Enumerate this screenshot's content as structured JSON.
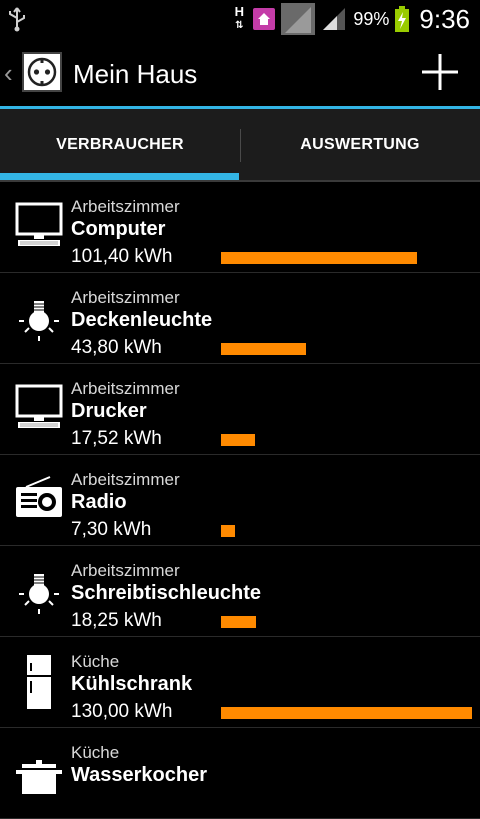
{
  "status_bar": {
    "network_type": "H",
    "battery_percent": "99%",
    "time": "9:36",
    "accent": "#33b5e5"
  },
  "action_bar": {
    "title": "Mein Haus",
    "add_icon": "plus-icon"
  },
  "tabs": [
    {
      "label": "VERBRAUCHER",
      "selected": true
    },
    {
      "label": "AUSWERTUNG",
      "selected": false
    }
  ],
  "consumers": [
    {
      "room": "Arbeitszimmer",
      "name": "Computer",
      "kwh": "101,40 kWh",
      "value": 101.4,
      "icon": "monitor-icon"
    },
    {
      "room": "Arbeitszimmer",
      "name": "Deckenleuchte",
      "kwh": "43,80 kWh",
      "value": 43.8,
      "icon": "lightbulb-icon"
    },
    {
      "room": "Arbeitszimmer",
      "name": "Drucker",
      "kwh": "17,52 kWh",
      "value": 17.52,
      "icon": "monitor-icon"
    },
    {
      "room": "Arbeitszimmer",
      "name": "Radio",
      "kwh": "7,30 kWh",
      "value": 7.3,
      "icon": "radio-icon"
    },
    {
      "room": "Arbeitszimmer",
      "name": "Schreibtischleuchte",
      "kwh": "18,25 kWh",
      "value": 18.25,
      "icon": "lightbulb-icon"
    },
    {
      "room": "Küche",
      "name": "Kühlschrank",
      "kwh": "130,00 kWh",
      "value": 130.0,
      "icon": "fridge-icon"
    },
    {
      "room": "Küche",
      "name": "Wasserkocher",
      "kwh": "",
      "value": null,
      "icon": "pot-icon"
    }
  ],
  "bar_color": "#ff8a00"
}
